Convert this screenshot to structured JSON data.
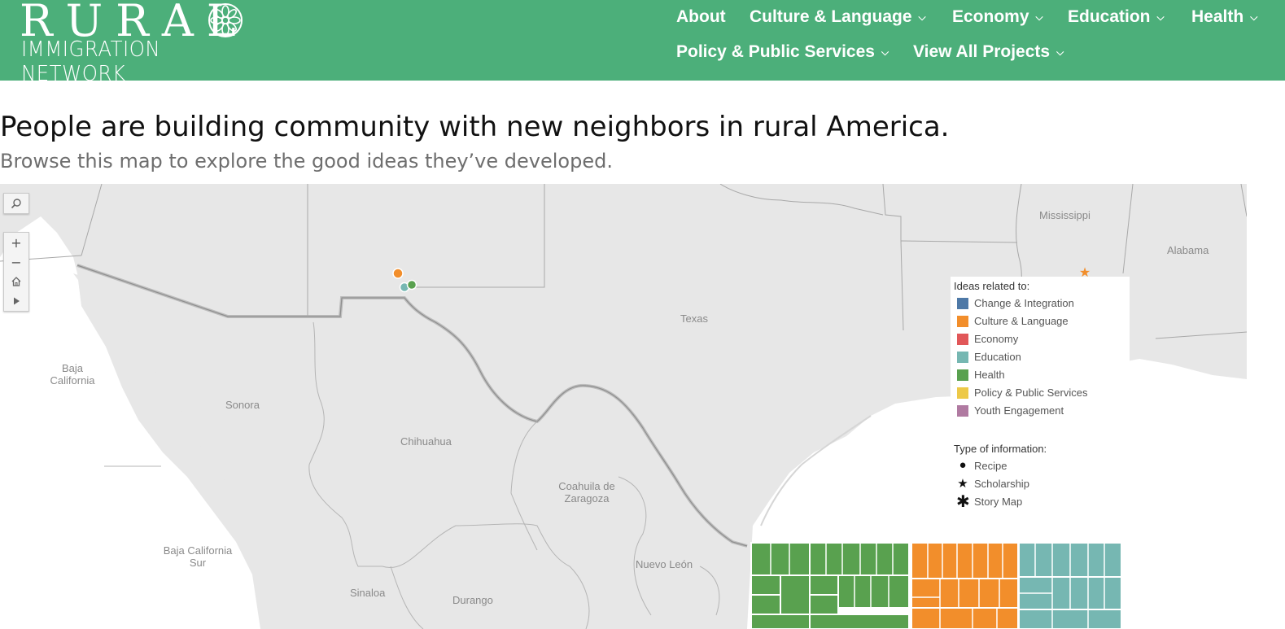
{
  "header": {
    "logo_line1": "RURAL",
    "logo_line2": "IMMIGRATION NETWORK",
    "background": "#4caf7a",
    "nav": [
      {
        "label": "About",
        "has_dropdown": false
      },
      {
        "label": "Culture & Language",
        "has_dropdown": true
      },
      {
        "label": "Economy",
        "has_dropdown": true
      },
      {
        "label": "Education",
        "has_dropdown": true
      },
      {
        "label": "Health",
        "has_dropdown": true
      },
      {
        "label": "Policy & Public Services",
        "has_dropdown": true
      },
      {
        "label": "View All Projects",
        "has_dropdown": true
      }
    ]
  },
  "main": {
    "headline": "People are building community with new neighbors in rural America.",
    "subline": "Browse this map to explore the good ideas they’ve developed."
  },
  "map": {
    "controls": {
      "search_icon": "search-icon",
      "zoom_in": "+",
      "zoom_out": "−",
      "home_icon": "home-icon",
      "play_icon": "play-icon"
    },
    "labels": [
      "Mississippi",
      "Alabama",
      "Texas",
      "Baja California",
      "Sonora",
      "Chihuahua",
      "Coahuila de Zaragoza",
      "Baja California Sur",
      "Sinaloa",
      "Durango",
      "Nuevo León"
    ],
    "legend": {
      "title": "Ideas related to:",
      "items": [
        {
          "label": "Change & Integration",
          "color": "#4e79a7"
        },
        {
          "label": "Culture & Language",
          "color": "#f28e2b"
        },
        {
          "label": "Economy",
          "color": "#e15759"
        },
        {
          "label": "Education",
          "color": "#76b7b2"
        },
        {
          "label": "Health",
          "color": "#59a14f"
        },
        {
          "label": "Policy & Public Services",
          "color": "#edc948"
        },
        {
          "label": "Youth Engagement",
          "color": "#b07aa1"
        }
      ]
    },
    "type_legend": {
      "title": "Type of information:",
      "items": [
        {
          "label": "Recipe",
          "icon": "circle-icon"
        },
        {
          "label": "Scholarship",
          "icon": "star-icon"
        },
        {
          "label": "Story Map",
          "icon": "asterisk-icon"
        }
      ]
    },
    "treemap_groups": [
      {
        "name": "Health",
        "color": "#59a14f"
      },
      {
        "name": "Culture & Language",
        "color": "#f28e2b"
      },
      {
        "name": "Education",
        "color": "#76b7b2"
      }
    ]
  }
}
